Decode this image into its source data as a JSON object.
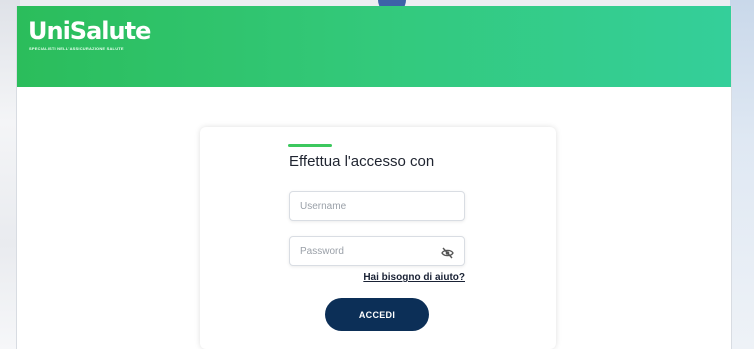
{
  "brand": {
    "logo_text": "UniSalute",
    "tagline": "SPECIALISTI NELL'ASSICURAZIONE SALUTE"
  },
  "login": {
    "title": "Effettua l'accesso con",
    "username_placeholder": "Username",
    "password_placeholder": "Password",
    "toggle_icon": "eye-slash-icon",
    "help_link": "Hai bisogno di aiuto?",
    "submit_label": "ACCEDI"
  },
  "colors": {
    "header_green": "#33c97b",
    "accent_green": "#3cc85e",
    "button_navy": "#0c2f57"
  }
}
